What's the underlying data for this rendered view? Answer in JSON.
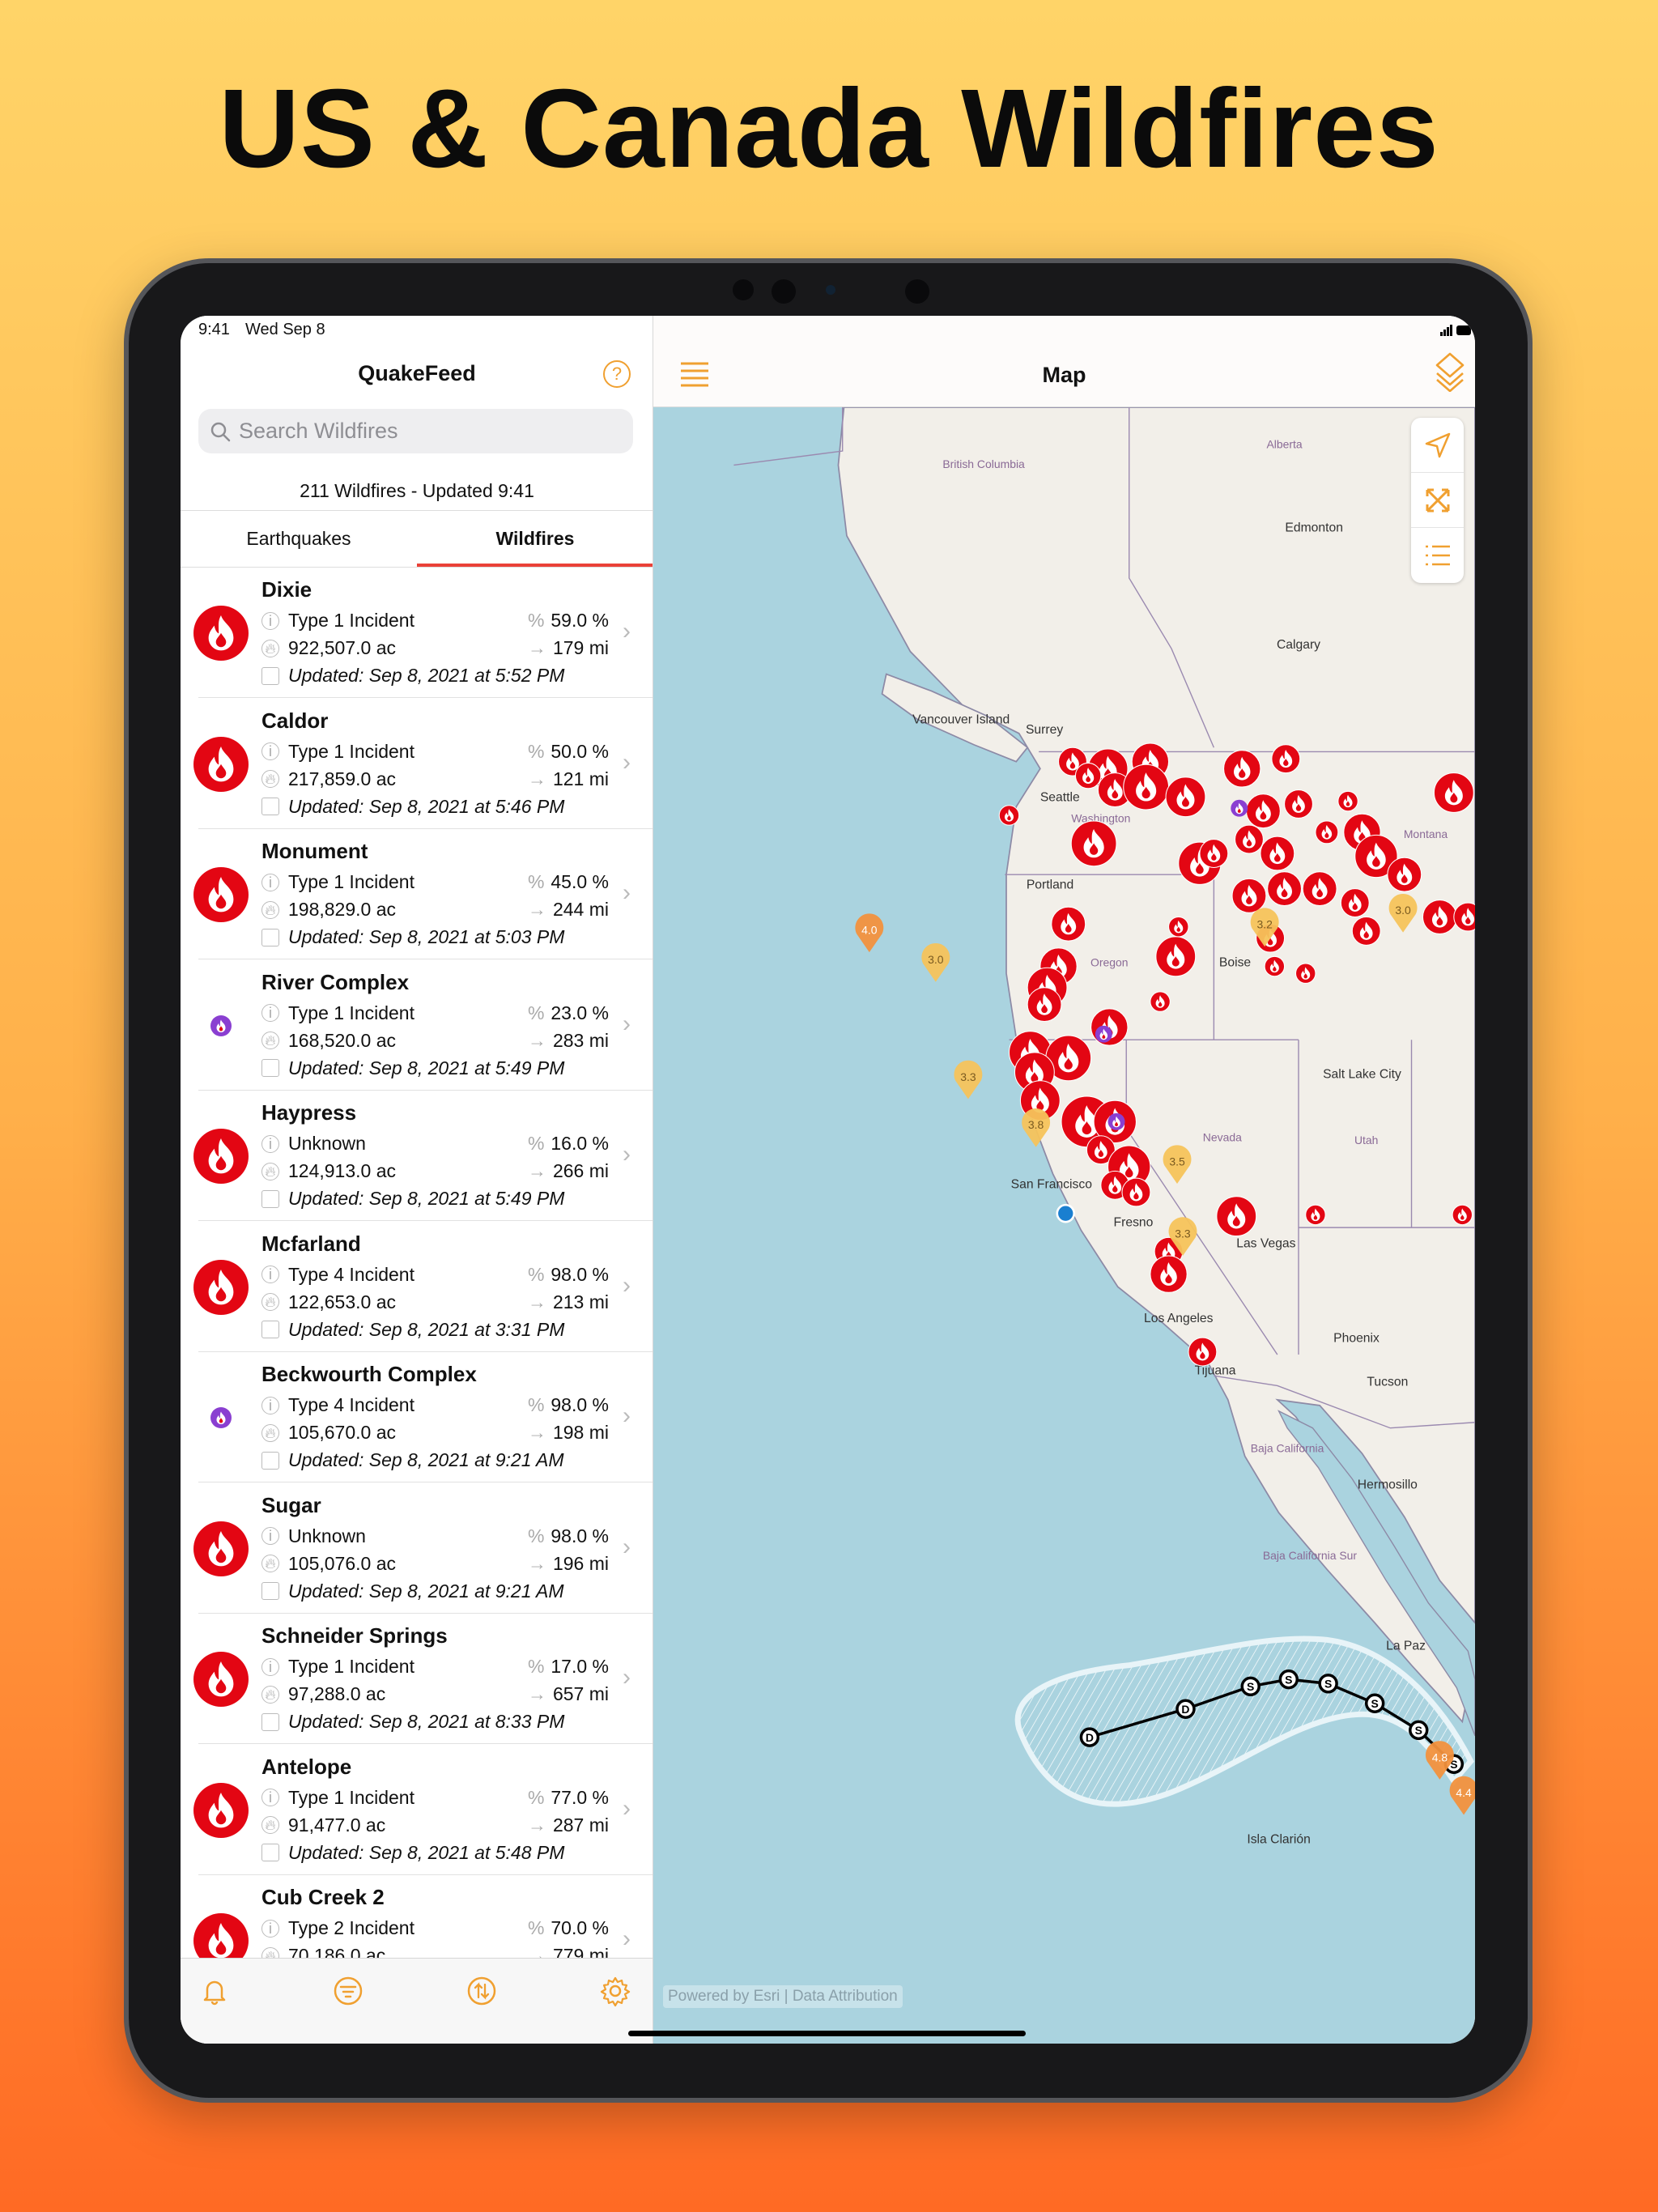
{
  "headline": "US & Canada Wildfires",
  "status": {
    "time": "9:41",
    "date": "Wed Sep 8"
  },
  "sidebar": {
    "title": "QuakeFeed",
    "help_icon": "question-circle-icon",
    "search_placeholder": "Search Wildfires",
    "count_text": "211 Wildfires - Updated 9:41",
    "tabs": [
      {
        "label": "Earthquakes",
        "selected": false
      },
      {
        "label": "Wildfires",
        "selected": true
      }
    ],
    "accent": "#f0a030",
    "tab_underline_color": "#ea4138",
    "items": [
      {
        "name": "Dixie",
        "type": "Type 1 Incident",
        "contained": "59.0 %",
        "acres": "922,507.0 ac",
        "distance": "179 mi",
        "updated": "Updated: Sep 8, 2021 at 5:52 PM",
        "kind": "fire"
      },
      {
        "name": "Caldor",
        "type": "Type 1 Incident",
        "contained": "50.0 %",
        "acres": "217,859.0 ac",
        "distance": "121 mi",
        "updated": "Updated: Sep 8, 2021 at 5:46 PM",
        "kind": "fire"
      },
      {
        "name": "Monument",
        "type": "Type 1 Incident",
        "contained": "45.0 %",
        "acres": "198,829.0 ac",
        "distance": "244 mi",
        "updated": "Updated: Sep 8, 2021 at 5:03 PM",
        "kind": "fire"
      },
      {
        "name": "River Complex",
        "type": "Type 1 Incident",
        "contained": "23.0 %",
        "acres": "168,520.0 ac",
        "distance": "283 mi",
        "updated": "Updated: Sep 8, 2021 at 5:49 PM",
        "kind": "complex"
      },
      {
        "name": "Haypress",
        "type": "Unknown",
        "contained": "16.0 %",
        "acres": "124,913.0 ac",
        "distance": "266 mi",
        "updated": "Updated: Sep 8, 2021 at 5:49 PM",
        "kind": "fire"
      },
      {
        "name": "Mcfarland",
        "type": "Type 4 Incident",
        "contained": "98.0 %",
        "acres": "122,653.0 ac",
        "distance": "213 mi",
        "updated": "Updated: Sep 8, 2021 at 3:31 PM",
        "kind": "fire"
      },
      {
        "name": "Beckwourth Complex",
        "type": "Type 4 Incident",
        "contained": "98.0 %",
        "acres": "105,670.0 ac",
        "distance": "198 mi",
        "updated": "Updated: Sep 8, 2021 at 9:21 AM",
        "kind": "complex"
      },
      {
        "name": "Sugar",
        "type": "Unknown",
        "contained": "98.0 %",
        "acres": "105,076.0 ac",
        "distance": "196 mi",
        "updated": "Updated: Sep 8, 2021 at 9:21 AM",
        "kind": "fire"
      },
      {
        "name": "Schneider Springs",
        "type": "Type 1 Incident",
        "contained": "17.0 %",
        "acres": "97,288.0 ac",
        "distance": "657 mi",
        "updated": "Updated: Sep 8, 2021 at 8:33 PM",
        "kind": "fire"
      },
      {
        "name": "Antelope",
        "type": "Type 1 Incident",
        "contained": "77.0 %",
        "acres": "91,477.0 ac",
        "distance": "287 mi",
        "updated": "Updated: Sep 8, 2021 at 5:48 PM",
        "kind": "fire"
      },
      {
        "name": "Cub Creek 2",
        "type": "Type 2 Incident",
        "contained": "70.0 %",
        "acres": "70,186.0 ac",
        "distance": "779 mi",
        "kind": "fire"
      }
    ],
    "tabbar": [
      "bell-icon",
      "filter-icon",
      "sort-icon",
      "gear-icon"
    ]
  },
  "map": {
    "title": "Map",
    "menu_icon": "hamburger-icon",
    "layers_icon": "layers-icon",
    "controls": [
      "location-arrow-icon",
      "expand-icon",
      "list-icon"
    ],
    "fire_color": "#e30613",
    "complex_color": "#8a3fd1",
    "ocean_color": "#aad3df",
    "land_color": "#f2efe9",
    "labels": [
      "British Columbia",
      "Alberta",
      "Edmonton",
      "Calgary",
      "Vancouver Island",
      "Surrey",
      "Seattle",
      "Washington",
      "Portland",
      "Oregon",
      "Boise",
      "Montana",
      "Salt Lake City",
      "Nevada",
      "Utah",
      "San Francisco",
      "Fresno",
      "Las Vegas",
      "Los Angeles",
      "Phoenix",
      "Tucson",
      "Tijuana",
      "Baja California",
      "Hermosillo",
      "Baja California Sur",
      "La Paz",
      "Isla Clarión"
    ],
    "quakes": [
      "4.0",
      "3.0",
      "3.3",
      "3.8",
      "3.5",
      "3.3",
      "3.2",
      "3.0",
      "4.8",
      "4.4"
    ],
    "storm_track": [
      "D",
      "D",
      "S",
      "S",
      "S",
      "S",
      "S",
      "S"
    ],
    "attribution": "Powered by Esri | Data Attribution"
  }
}
